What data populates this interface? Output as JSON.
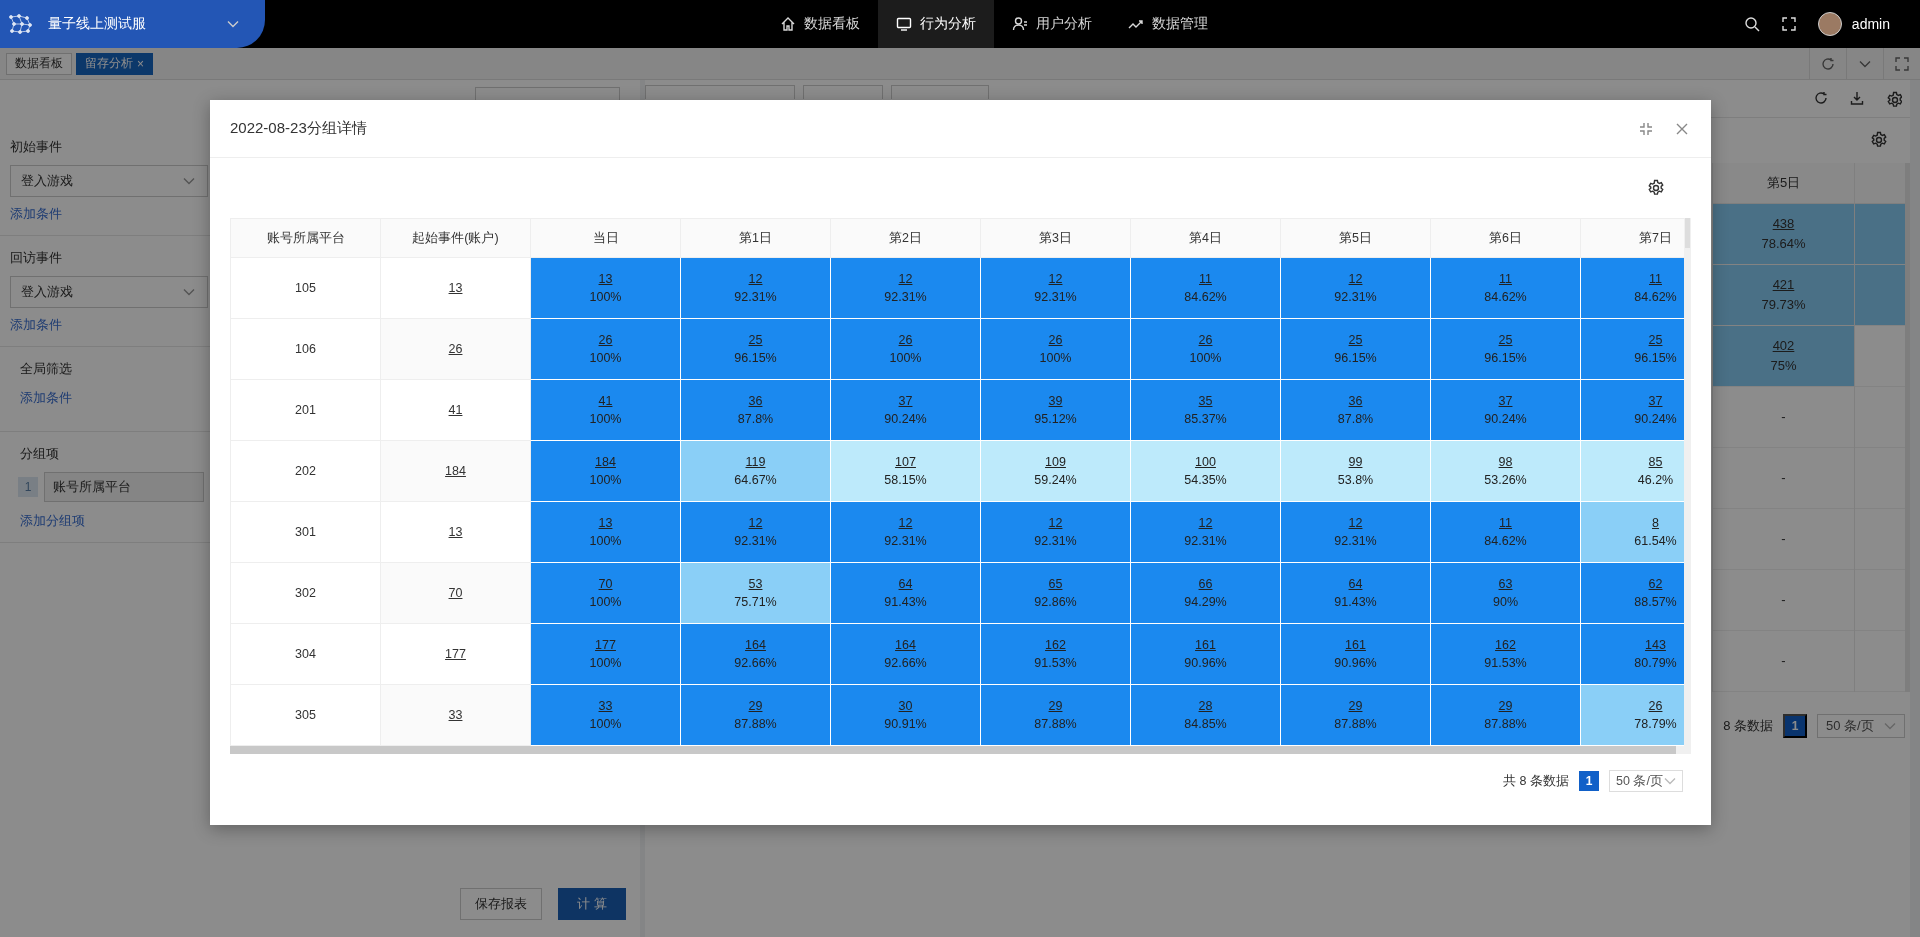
{
  "app": {
    "title": "量子线上测试服"
  },
  "nav": [
    {
      "label": "数据看板",
      "selected": false
    },
    {
      "label": "行为分析",
      "selected": true
    },
    {
      "label": "用户分析",
      "selected": false
    },
    {
      "label": "数据管理",
      "selected": false
    }
  ],
  "user": {
    "name": "admin"
  },
  "page_tabs": [
    {
      "label": "数据看板",
      "selected": false
    },
    {
      "label": "留存分析",
      "selected": true,
      "close": "×"
    }
  ],
  "sidebar": {
    "sections": [
      {
        "kind": "event",
        "title": "初始事件",
        "select": "登入游戏",
        "link": "添加条件"
      },
      {
        "kind": "event",
        "title": "回访事件",
        "select": "登入游戏",
        "link": "添加条件"
      },
      {
        "kind": "filter",
        "title": "全局筛选",
        "link": "添加条件"
      },
      {
        "kind": "group",
        "title": "分组项",
        "items": [
          {
            "index": "1",
            "value": "账号所属平台"
          }
        ],
        "link": "添加分组项"
      }
    ],
    "buttons": [
      {
        "label": "保存报表",
        "kind": "secondary"
      },
      {
        "label": "计 算",
        "kind": "primary"
      }
    ]
  },
  "report": {
    "column": "第5日",
    "rows": [
      {
        "count": "438",
        "rate": "78.64%",
        "highlighted": true,
        "next_highlighted": true
      },
      {
        "count": "421",
        "rate": "79.73%",
        "highlighted": true,
        "next_highlighted": true
      },
      {
        "count": "402",
        "rate": "75%",
        "highlighted": true,
        "next_highlighted": false
      },
      {
        "text": "-",
        "highlighted": false,
        "next_highlighted": false
      },
      {
        "text": "-",
        "highlighted": false,
        "next_highlighted": false
      },
      {
        "text": "-",
        "highlighted": false,
        "next_highlighted": false
      },
      {
        "text": "-",
        "highlighted": false,
        "next_highlighted": false
      },
      {
        "text": "-",
        "highlighted": false,
        "next_highlighted": false
      }
    ],
    "pagination": {
      "total": "8 条数据",
      "page": "1",
      "size": "50 条/页"
    }
  },
  "modal": {
    "title": "2022-08-23分组详情",
    "table": {
      "columns": [
        "账号所属平台",
        "起始事件(账户)",
        "当日",
        "第1日",
        "第2日",
        "第3日",
        "第4日",
        "第5日",
        "第6日",
        "第7日"
      ],
      "rows": [
        {
          "cells": [
            {
              "kind": "label",
              "text": "105"
            },
            {
              "kind": "link",
              "text": "13"
            },
            {
              "kind": "retention",
              "count": "13",
              "rate": "100%",
              "color": "#1b89ef"
            },
            {
              "kind": "retention",
              "count": "12",
              "rate": "92.31%",
              "color": "#1b89ef"
            },
            {
              "kind": "retention",
              "count": "12",
              "rate": "92.31%",
              "color": "#1b89ef"
            },
            {
              "kind": "retention",
              "count": "12",
              "rate": "92.31%",
              "color": "#1b89ef"
            },
            {
              "kind": "retention",
              "count": "11",
              "rate": "84.62%",
              "color": "#1b89ef"
            },
            {
              "kind": "retention",
              "count": "12",
              "rate": "92.31%",
              "color": "#1b89ef"
            },
            {
              "kind": "retention",
              "count": "11",
              "rate": "84.62%",
              "color": "#1b89ef"
            },
            {
              "kind": "retention",
              "count": "11",
              "rate": "84.62%",
              "color": "#1b89ef"
            }
          ]
        },
        {
          "cells": [
            {
              "kind": "label",
              "text": "106"
            },
            {
              "kind": "link",
              "text": "26"
            },
            {
              "kind": "retention",
              "count": "26",
              "rate": "100%",
              "color": "#1b89ef"
            },
            {
              "kind": "retention",
              "count": "25",
              "rate": "96.15%",
              "color": "#1b89ef"
            },
            {
              "kind": "retention",
              "count": "26",
              "rate": "100%",
              "color": "#1b89ef"
            },
            {
              "kind": "retention",
              "count": "26",
              "rate": "100%",
              "color": "#1b89ef"
            },
            {
              "kind": "retention",
              "count": "26",
              "rate": "100%",
              "color": "#1b89ef"
            },
            {
              "kind": "retention",
              "count": "25",
              "rate": "96.15%",
              "color": "#1b89ef"
            },
            {
              "kind": "retention",
              "count": "25",
              "rate": "96.15%",
              "color": "#1b89ef"
            },
            {
              "kind": "retention",
              "count": "25",
              "rate": "96.15%",
              "color": "#1b89ef"
            }
          ]
        },
        {
          "cells": [
            {
              "kind": "label",
              "text": "201"
            },
            {
              "kind": "link",
              "text": "41"
            },
            {
              "kind": "retention",
              "count": "41",
              "rate": "100%",
              "color": "#1b89ef"
            },
            {
              "kind": "retention",
              "count": "36",
              "rate": "87.8%",
              "color": "#1b89ef"
            },
            {
              "kind": "retention",
              "count": "37",
              "rate": "90.24%",
              "color": "#1b89ef"
            },
            {
              "kind": "retention",
              "count": "39",
              "rate": "95.12%",
              "color": "#1b89ef"
            },
            {
              "kind": "retention",
              "count": "35",
              "rate": "85.37%",
              "color": "#1b89ef"
            },
            {
              "kind": "retention",
              "count": "36",
              "rate": "87.8%",
              "color": "#1b89ef"
            },
            {
              "kind": "retention",
              "count": "37",
              "rate": "90.24%",
              "color": "#1b89ef"
            },
            {
              "kind": "retention",
              "count": "37",
              "rate": "90.24%",
              "color": "#1b89ef"
            }
          ]
        },
        {
          "cells": [
            {
              "kind": "label",
              "text": "202"
            },
            {
              "kind": "link",
              "text": "184"
            },
            {
              "kind": "retention",
              "count": "184",
              "rate": "100%",
              "color": "#1b89ef"
            },
            {
              "kind": "retention",
              "count": "119",
              "rate": "64.67%",
              "color": "#8acff7"
            },
            {
              "kind": "retention",
              "count": "107",
              "rate": "58.15%",
              "color": "#bdeafb"
            },
            {
              "kind": "retention",
              "count": "109",
              "rate": "59.24%",
              "color": "#bdeafb"
            },
            {
              "kind": "retention",
              "count": "100",
              "rate": "54.35%",
              "color": "#bdeafb"
            },
            {
              "kind": "retention",
              "count": "99",
              "rate": "53.8%",
              "color": "#bdeafb"
            },
            {
              "kind": "retention",
              "count": "98",
              "rate": "53.26%",
              "color": "#bdeafb"
            },
            {
              "kind": "retention",
              "count": "85",
              "rate": "46.2%",
              "color": "#bdeafb"
            }
          ]
        },
        {
          "cells": [
            {
              "kind": "label",
              "text": "301"
            },
            {
              "kind": "link",
              "text": "13"
            },
            {
              "kind": "retention",
              "count": "13",
              "rate": "100%",
              "color": "#1b89ef"
            },
            {
              "kind": "retention",
              "count": "12",
              "rate": "92.31%",
              "color": "#1b89ef"
            },
            {
              "kind": "retention",
              "count": "12",
              "rate": "92.31%",
              "color": "#1b89ef"
            },
            {
              "kind": "retention",
              "count": "12",
              "rate": "92.31%",
              "color": "#1b89ef"
            },
            {
              "kind": "retention",
              "count": "12",
              "rate": "92.31%",
              "color": "#1b89ef"
            },
            {
              "kind": "retention",
              "count": "12",
              "rate": "92.31%",
              "color": "#1b89ef"
            },
            {
              "kind": "retention",
              "count": "11",
              "rate": "84.62%",
              "color": "#1b89ef"
            },
            {
              "kind": "retention",
              "count": "8",
              "rate": "61.54%",
              "color": "#8acff7"
            }
          ]
        },
        {
          "cells": [
            {
              "kind": "label",
              "text": "302"
            },
            {
              "kind": "link",
              "text": "70"
            },
            {
              "kind": "retention",
              "count": "70",
              "rate": "100%",
              "color": "#1b89ef"
            },
            {
              "kind": "retention",
              "count": "53",
              "rate": "75.71%",
              "color": "#8acff7"
            },
            {
              "kind": "retention",
              "count": "64",
              "rate": "91.43%",
              "color": "#1b89ef"
            },
            {
              "kind": "retention",
              "count": "65",
              "rate": "92.86%",
              "color": "#1b89ef"
            },
            {
              "kind": "retention",
              "count": "66",
              "rate": "94.29%",
              "color": "#1b89ef"
            },
            {
              "kind": "retention",
              "count": "64",
              "rate": "91.43%",
              "color": "#1b89ef"
            },
            {
              "kind": "retention",
              "count": "63",
              "rate": "90%",
              "color": "#1b89ef"
            },
            {
              "kind": "retention",
              "count": "62",
              "rate": "88.57%",
              "color": "#1b89ef"
            }
          ]
        },
        {
          "cells": [
            {
              "kind": "label",
              "text": "304"
            },
            {
              "kind": "link",
              "text": "177"
            },
            {
              "kind": "retention",
              "count": "177",
              "rate": "100%",
              "color": "#1b89ef"
            },
            {
              "kind": "retention",
              "count": "164",
              "rate": "92.66%",
              "color": "#1b89ef"
            },
            {
              "kind": "retention",
              "count": "164",
              "rate": "92.66%",
              "color": "#1b89ef"
            },
            {
              "kind": "retention",
              "count": "162",
              "rate": "91.53%",
              "color": "#1b89ef"
            },
            {
              "kind": "retention",
              "count": "161",
              "rate": "90.96%",
              "color": "#1b89ef"
            },
            {
              "kind": "retention",
              "count": "161",
              "rate": "90.96%",
              "color": "#1b89ef"
            },
            {
              "kind": "retention",
              "count": "162",
              "rate": "91.53%",
              "color": "#1b89ef"
            },
            {
              "kind": "retention",
              "count": "143",
              "rate": "80.79%",
              "color": "#1b89ef"
            }
          ]
        },
        {
          "cells": [
            {
              "kind": "label",
              "text": "305"
            },
            {
              "kind": "link",
              "text": "33"
            },
            {
              "kind": "retention",
              "count": "33",
              "rate": "100%",
              "color": "#1b89ef"
            },
            {
              "kind": "retention",
              "count": "29",
              "rate": "87.88%",
              "color": "#1b89ef"
            },
            {
              "kind": "retention",
              "count": "30",
              "rate": "90.91%",
              "color": "#1b89ef"
            },
            {
              "kind": "retention",
              "count": "29",
              "rate": "87.88%",
              "color": "#1b89ef"
            },
            {
              "kind": "retention",
              "count": "28",
              "rate": "84.85%",
              "color": "#1b89ef"
            },
            {
              "kind": "retention",
              "count": "29",
              "rate": "87.88%",
              "color": "#1b89ef"
            },
            {
              "kind": "retention",
              "count": "29",
              "rate": "87.88%",
              "color": "#1b89ef"
            },
            {
              "kind": "retention",
              "count": "26",
              "rate": "78.79%",
              "color": "#8acff7"
            }
          ]
        }
      ]
    },
    "pagination": {
      "total": "共 8 条数据",
      "page": "1",
      "size": "50 条/页"
    }
  }
}
